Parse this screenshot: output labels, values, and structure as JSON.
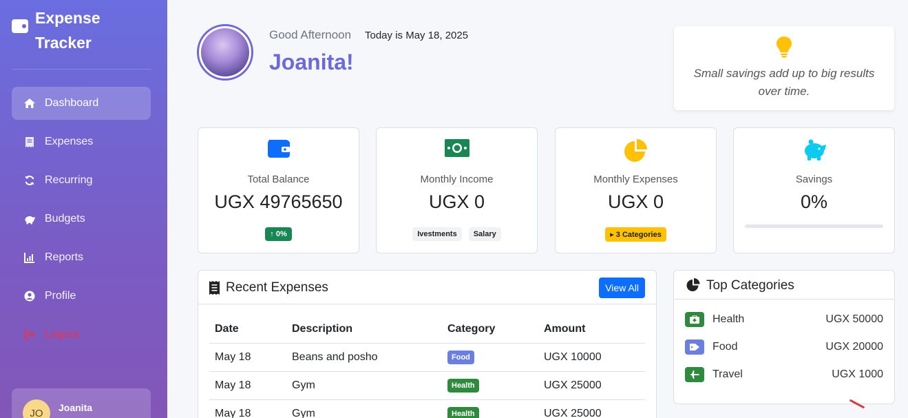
{
  "app": {
    "name": "Expense Tracker"
  },
  "sidebar": {
    "items": [
      {
        "label": "Dashboard",
        "icon": "home-icon",
        "active": true
      },
      {
        "label": "Expenses",
        "icon": "receipt-icon"
      },
      {
        "label": "Recurring",
        "icon": "sync-icon"
      },
      {
        "label": "Budgets",
        "icon": "piggy-bank-icon"
      },
      {
        "label": "Reports",
        "icon": "chart-icon"
      },
      {
        "label": "Profile",
        "icon": "user-circle-icon"
      },
      {
        "label": "Logout",
        "icon": "logout-icon"
      }
    ],
    "user": {
      "initials": "JO",
      "name": "Joanita"
    }
  },
  "header": {
    "greeting": "Good Afternoon",
    "today": "Today is May 18, 2025",
    "name": "Joanita!"
  },
  "tip": {
    "icon": "lightbulb-icon",
    "text": "Small savings add up to big results over time."
  },
  "stats": {
    "balance": {
      "label": "Total Balance",
      "value": "UGX 49765650",
      "badge": "↑ 0%"
    },
    "income": {
      "label": "Monthly Income",
      "value": "UGX 0",
      "tags": [
        "Ivestments",
        "Salary"
      ]
    },
    "expenses": {
      "label": "Monthly Expenses",
      "value": "UGX 0",
      "badge": "3 Categories"
    },
    "savings": {
      "label": "Savings",
      "value": "0%",
      "progress": 0
    }
  },
  "recent": {
    "title": "Recent Expenses",
    "view_all": "View All",
    "columns": [
      "Date",
      "Description",
      "Category",
      "Amount"
    ],
    "rows": [
      {
        "date": "May 18",
        "description": "Beans and posho",
        "category": "Food",
        "amount": "UGX 10000"
      },
      {
        "date": "May 18",
        "description": "Gym",
        "category": "Health",
        "amount": "UGX 25000"
      },
      {
        "date": "May 18",
        "description": "Gym",
        "category": "Health",
        "amount": "UGX 25000"
      }
    ]
  },
  "top_categories": {
    "title": "Top Categories",
    "items": [
      {
        "name": "Health",
        "amount": "UGX 50000",
        "color": "#2e8b3e"
      },
      {
        "name": "Food",
        "amount": "UGX 20000",
        "color": "#6b7fe0"
      },
      {
        "name": "Travel",
        "amount": "UGX 1000",
        "color": "#2e8b3e"
      }
    ]
  },
  "colors": {
    "accent": "#6a6ad8",
    "primary": "#0d6efd",
    "success": "#198754",
    "warning": "#ffc107",
    "danger": "#e8334a",
    "info": "#0dcaf0"
  }
}
